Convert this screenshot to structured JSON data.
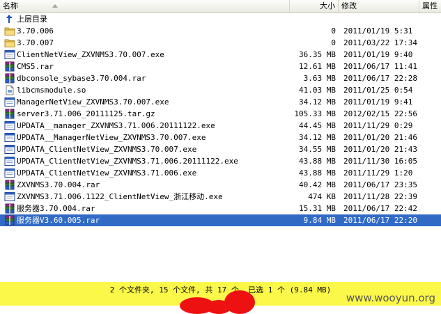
{
  "header": {
    "col_name": "名称",
    "col_size": "大小",
    "col_modified": "修改",
    "col_attributes": "属性"
  },
  "files": [
    {
      "name": "上层目录",
      "size": "",
      "modified": "",
      "icon": "up-folder-icon"
    },
    {
      "name": "3.70.006",
      "size": "0",
      "modified": "2011/01/19 5:31",
      "icon": "folder-icon"
    },
    {
      "name": "3.70.007",
      "size": "0",
      "modified": "2011/03/22 17:34",
      "icon": "folder-icon"
    },
    {
      "name": "ClientNetView_ZXVNMS3.70.007.exe",
      "size": "36.35 MB",
      "modified": "2011/01/19 9:40",
      "icon": "exe-icon"
    },
    {
      "name": "CMS5.rar",
      "size": "12.61 MB",
      "modified": "2011/06/17 11:41",
      "icon": "rar-icon"
    },
    {
      "name": "dbconsole_sybase3.70.004.rar",
      "size": "3.63 MB",
      "modified": "2011/06/17 22:28",
      "icon": "rar-icon"
    },
    {
      "name": "libcmsmodule.so",
      "size": "41.03 MB",
      "modified": "2011/01/25 0:54",
      "icon": "file-icon"
    },
    {
      "name": "ManagerNetView_ZXVNMS3.70.007.exe",
      "size": "34.12 MB",
      "modified": "2011/01/19 9:41",
      "icon": "exe-icon"
    },
    {
      "name": "server3.71.006_20111125.tar.gz",
      "size": "105.33 MB",
      "modified": "2012/02/15 22:56",
      "icon": "rar-icon"
    },
    {
      "name": "UPDATA__manager_ZXVNMS3.71.006.20111122.exe",
      "size": "44.45 MB",
      "modified": "2011/11/29 0:29",
      "icon": "exe-icon"
    },
    {
      "name": "UPDATA__ManagerNetView_ZXVNMS3.70.007.exe",
      "size": "34.12 MB",
      "modified": "2011/01/20 21:46",
      "icon": "exe-icon"
    },
    {
      "name": "UPDATA_ClientNetView_ZXVNMS3.70.007.exe",
      "size": "34.55 MB",
      "modified": "2011/01/20 21:43",
      "icon": "exe-icon"
    },
    {
      "name": "UPDATA_ClientNetView_ZXVNMS3.71.006.20111122.exe",
      "size": "43.88 MB",
      "modified": "2011/11/30 16:05",
      "icon": "exe-icon"
    },
    {
      "name": "UPDATA_ClientNetView_ZXVNMS3.71.006.exe",
      "size": "43.88 MB",
      "modified": "2011/11/29 1:20",
      "icon": "exe-icon"
    },
    {
      "name": "ZXVNMS3.70.004.rar",
      "size": "40.42 MB",
      "modified": "2011/06/17 23:35",
      "icon": "rar-icon"
    },
    {
      "name": "ZXVNMS3.71.006.1122_ClientNetView_浙江移动.exe",
      "size": "474 KB",
      "modified": "2011/11/28 22:39",
      "icon": "exe-icon"
    },
    {
      "name": "服务器3.70.004.rar",
      "size": "15.31 MB",
      "modified": "2011/06/17 22:42",
      "icon": "rar-icon"
    },
    {
      "name": "服务器V3.60.005.rar",
      "size": "9.84 MB",
      "modified": "2011/06/17 22:20",
      "icon": "rar-icon",
      "selected": true
    }
  ],
  "status": {
    "text": "2 个文件夹, 15 个文件, 共 17 个. 已选 1 个 (9.84 MB)"
  },
  "watermark": "www.wooyun.org",
  "colors": {
    "selection": "#316ac5",
    "statusbar": "#fbf84a",
    "redaction": "#ee1111"
  }
}
